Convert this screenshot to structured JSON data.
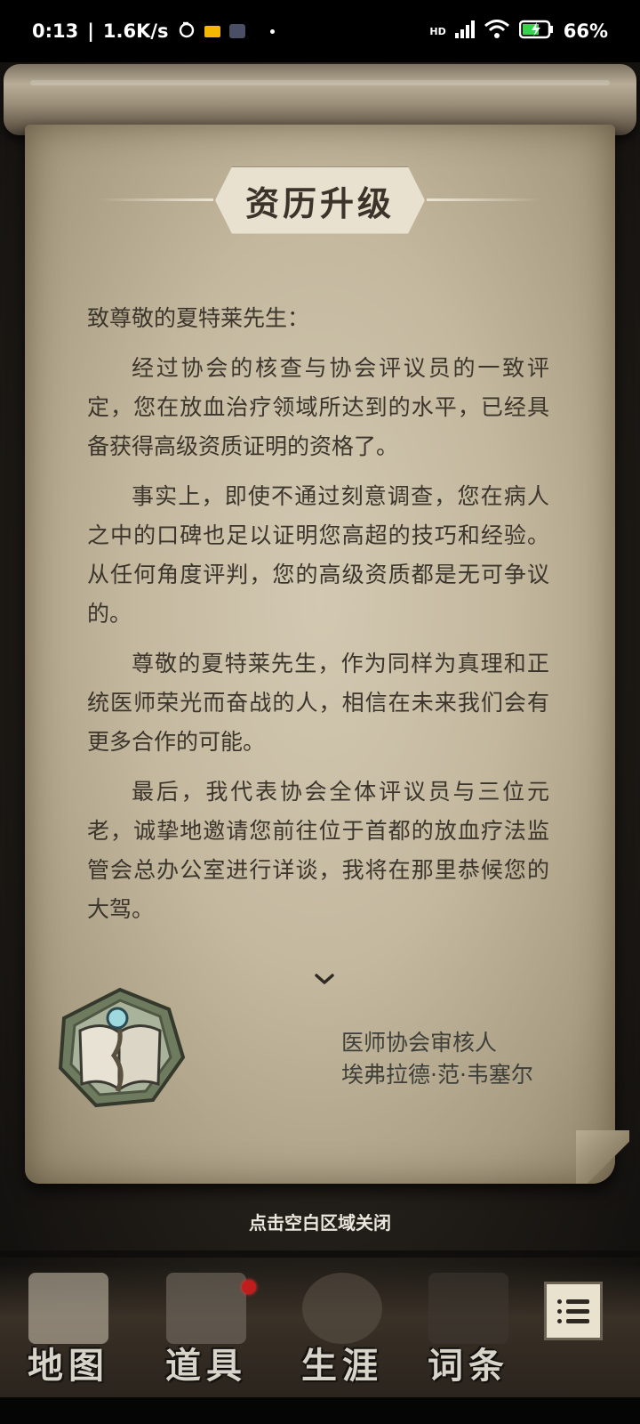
{
  "status_bar": {
    "time": "0:13",
    "speed": "1.6K/s",
    "network": "HD",
    "battery": "66%",
    "icons": [
      "wechat-like-icon",
      "mail-icon",
      "app-icon",
      "signal-icon",
      "wifi-icon",
      "battery-charging-icon"
    ]
  },
  "letter": {
    "title": "资历升级",
    "greeting": "致尊敬的夏特莱先生：",
    "paragraphs": [
      "经过协会的核查与协会评议员的一致评定，您在放血治疗领域所达到的水平，已经具备获得高级资质证明的资格了。",
      "事实上，即使不通过刻意调查，您在病人之中的口碑也足以证明您高超的技巧和经验。从任何角度评判，您的高级资质都是无可争议的。",
      "尊敬的夏特莱先生，作为同样为真理和正统医师荣光而奋战的人，相信在未来我们会有更多合作的可能。",
      "最后，我代表协会全体评议员与三位元老，诚挚地邀请您前往位于首都的放血疗法监管会总办公室进行详谈，我将在那里恭候您的大驾。"
    ],
    "signer_title": "医师协会审核人",
    "signer_name": "埃弗拉德·范·韦塞尔"
  },
  "close_hint": "点击空白区域关闭",
  "nav": {
    "items": [
      {
        "label": "地图",
        "icon": "map-icon"
      },
      {
        "label": "道具",
        "icon": "items-icon"
      },
      {
        "label": "生涯",
        "icon": "career-medal-icon"
      },
      {
        "label": "词条",
        "icon": "glossary-book-icon"
      }
    ],
    "menu_icon": "menu-list-icon"
  },
  "colors": {
    "paper": "#c4b99f",
    "ink": "#3c352c",
    "notification": "#c11d1d"
  }
}
